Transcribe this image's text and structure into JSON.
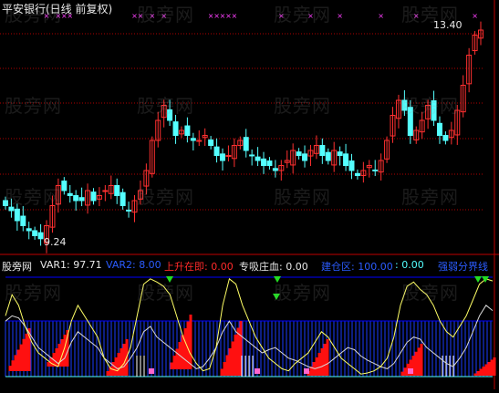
{
  "watermark": "股旁网",
  "main_title": "平安银行(日线 前复权)",
  "price_high_label": "13.40",
  "price_low_label": "9.24",
  "colors": {
    "up": "#ff3030",
    "down": "#54ffff",
    "grid": "#b00000",
    "marker": "#ff40ff",
    "yellow": "#ffff66",
    "blue": "#0000ff",
    "green": "#22dd22"
  },
  "indicator_bar": {
    "name": "股旁网",
    "var1_label": "VAR1: 97.71",
    "var2_label": "VAR2: 8.00",
    "rise_label": "上升在即: 0.00",
    "absorb_label": "专吸庄血: 0.00",
    "build_label": "建仓区: 100.00",
    "build_value": ": 0.00",
    "boundary_label": "强弱分界线"
  },
  "chart_data": [
    {
      "type": "candlestick",
      "title": "平安银行(日线 前复权)",
      "annotations": [
        "13.40",
        "9.24"
      ],
      "ylim": [
        9.0,
        13.6
      ],
      "close_path": [
        9.9,
        9.8,
        9.6,
        9.5,
        9.4,
        9.3,
        9.24,
        9.5,
        9.9,
        10.3,
        10.2,
        10.1,
        10.0,
        10.0,
        10.2,
        10.0,
        10.1,
        10.2,
        10.3,
        10.1,
        9.9,
        9.8,
        10.0,
        10.2,
        10.6,
        11.2,
        11.6,
        11.9,
        11.6,
        11.3,
        11.4,
        11.3,
        11.2,
        11.2,
        11.3,
        11.1,
        10.9,
        10.8,
        10.9,
        11.1,
        11.2,
        11.0,
        10.9,
        10.8,
        10.7,
        10.7,
        10.6,
        10.7,
        10.8,
        11.0,
        10.9,
        10.8,
        11.0,
        11.1,
        10.9,
        10.8,
        11.0,
        10.9,
        10.7,
        10.6,
        10.5,
        10.6,
        10.7,
        10.6,
        10.8,
        11.2,
        11.7,
        12.0,
        11.8,
        11.3,
        11.4,
        11.6,
        11.9,
        11.6,
        11.3,
        11.2,
        11.4,
        11.8,
        12.3,
        12.9,
        13.3,
        13.4
      ]
    },
    {
      "type": "line",
      "series_note": "indicator panel",
      "ylim": [
        0,
        100
      ],
      "yellow_line": [
        60,
        80,
        70,
        50,
        35,
        25,
        20,
        15,
        12,
        30,
        55,
        70,
        60,
        50,
        40,
        20,
        10,
        8,
        15,
        30,
        60,
        90,
        95,
        92,
        88,
        80,
        60,
        40,
        25,
        15,
        8,
        10,
        30,
        70,
        95,
        90,
        70,
        55,
        40,
        30,
        20,
        15,
        10,
        8,
        15,
        20,
        25,
        35,
        45,
        40,
        30,
        20,
        15,
        10,
        5,
        6,
        8,
        12,
        20,
        40,
        70,
        88,
        92,
        85,
        80,
        70,
        55,
        45,
        40,
        50,
        60,
        75,
        90,
        95,
        93
      ],
      "white_line": [
        55,
        60,
        58,
        50,
        40,
        30,
        25,
        20,
        15,
        20,
        35,
        45,
        40,
        35,
        30,
        20,
        15,
        10,
        12,
        20,
        30,
        45,
        50,
        40,
        35,
        30,
        25,
        20,
        15,
        10,
        12,
        20,
        30,
        45,
        55,
        45,
        40,
        35,
        30,
        25,
        28,
        30,
        25,
        20,
        18,
        15,
        12,
        10,
        12,
        15,
        20,
        25,
        30,
        28,
        22,
        18,
        15,
        12,
        10,
        15,
        25,
        35,
        40,
        38,
        30,
        25,
        20,
        15,
        12,
        20,
        30,
        45,
        60,
        70,
        65
      ]
    }
  ]
}
